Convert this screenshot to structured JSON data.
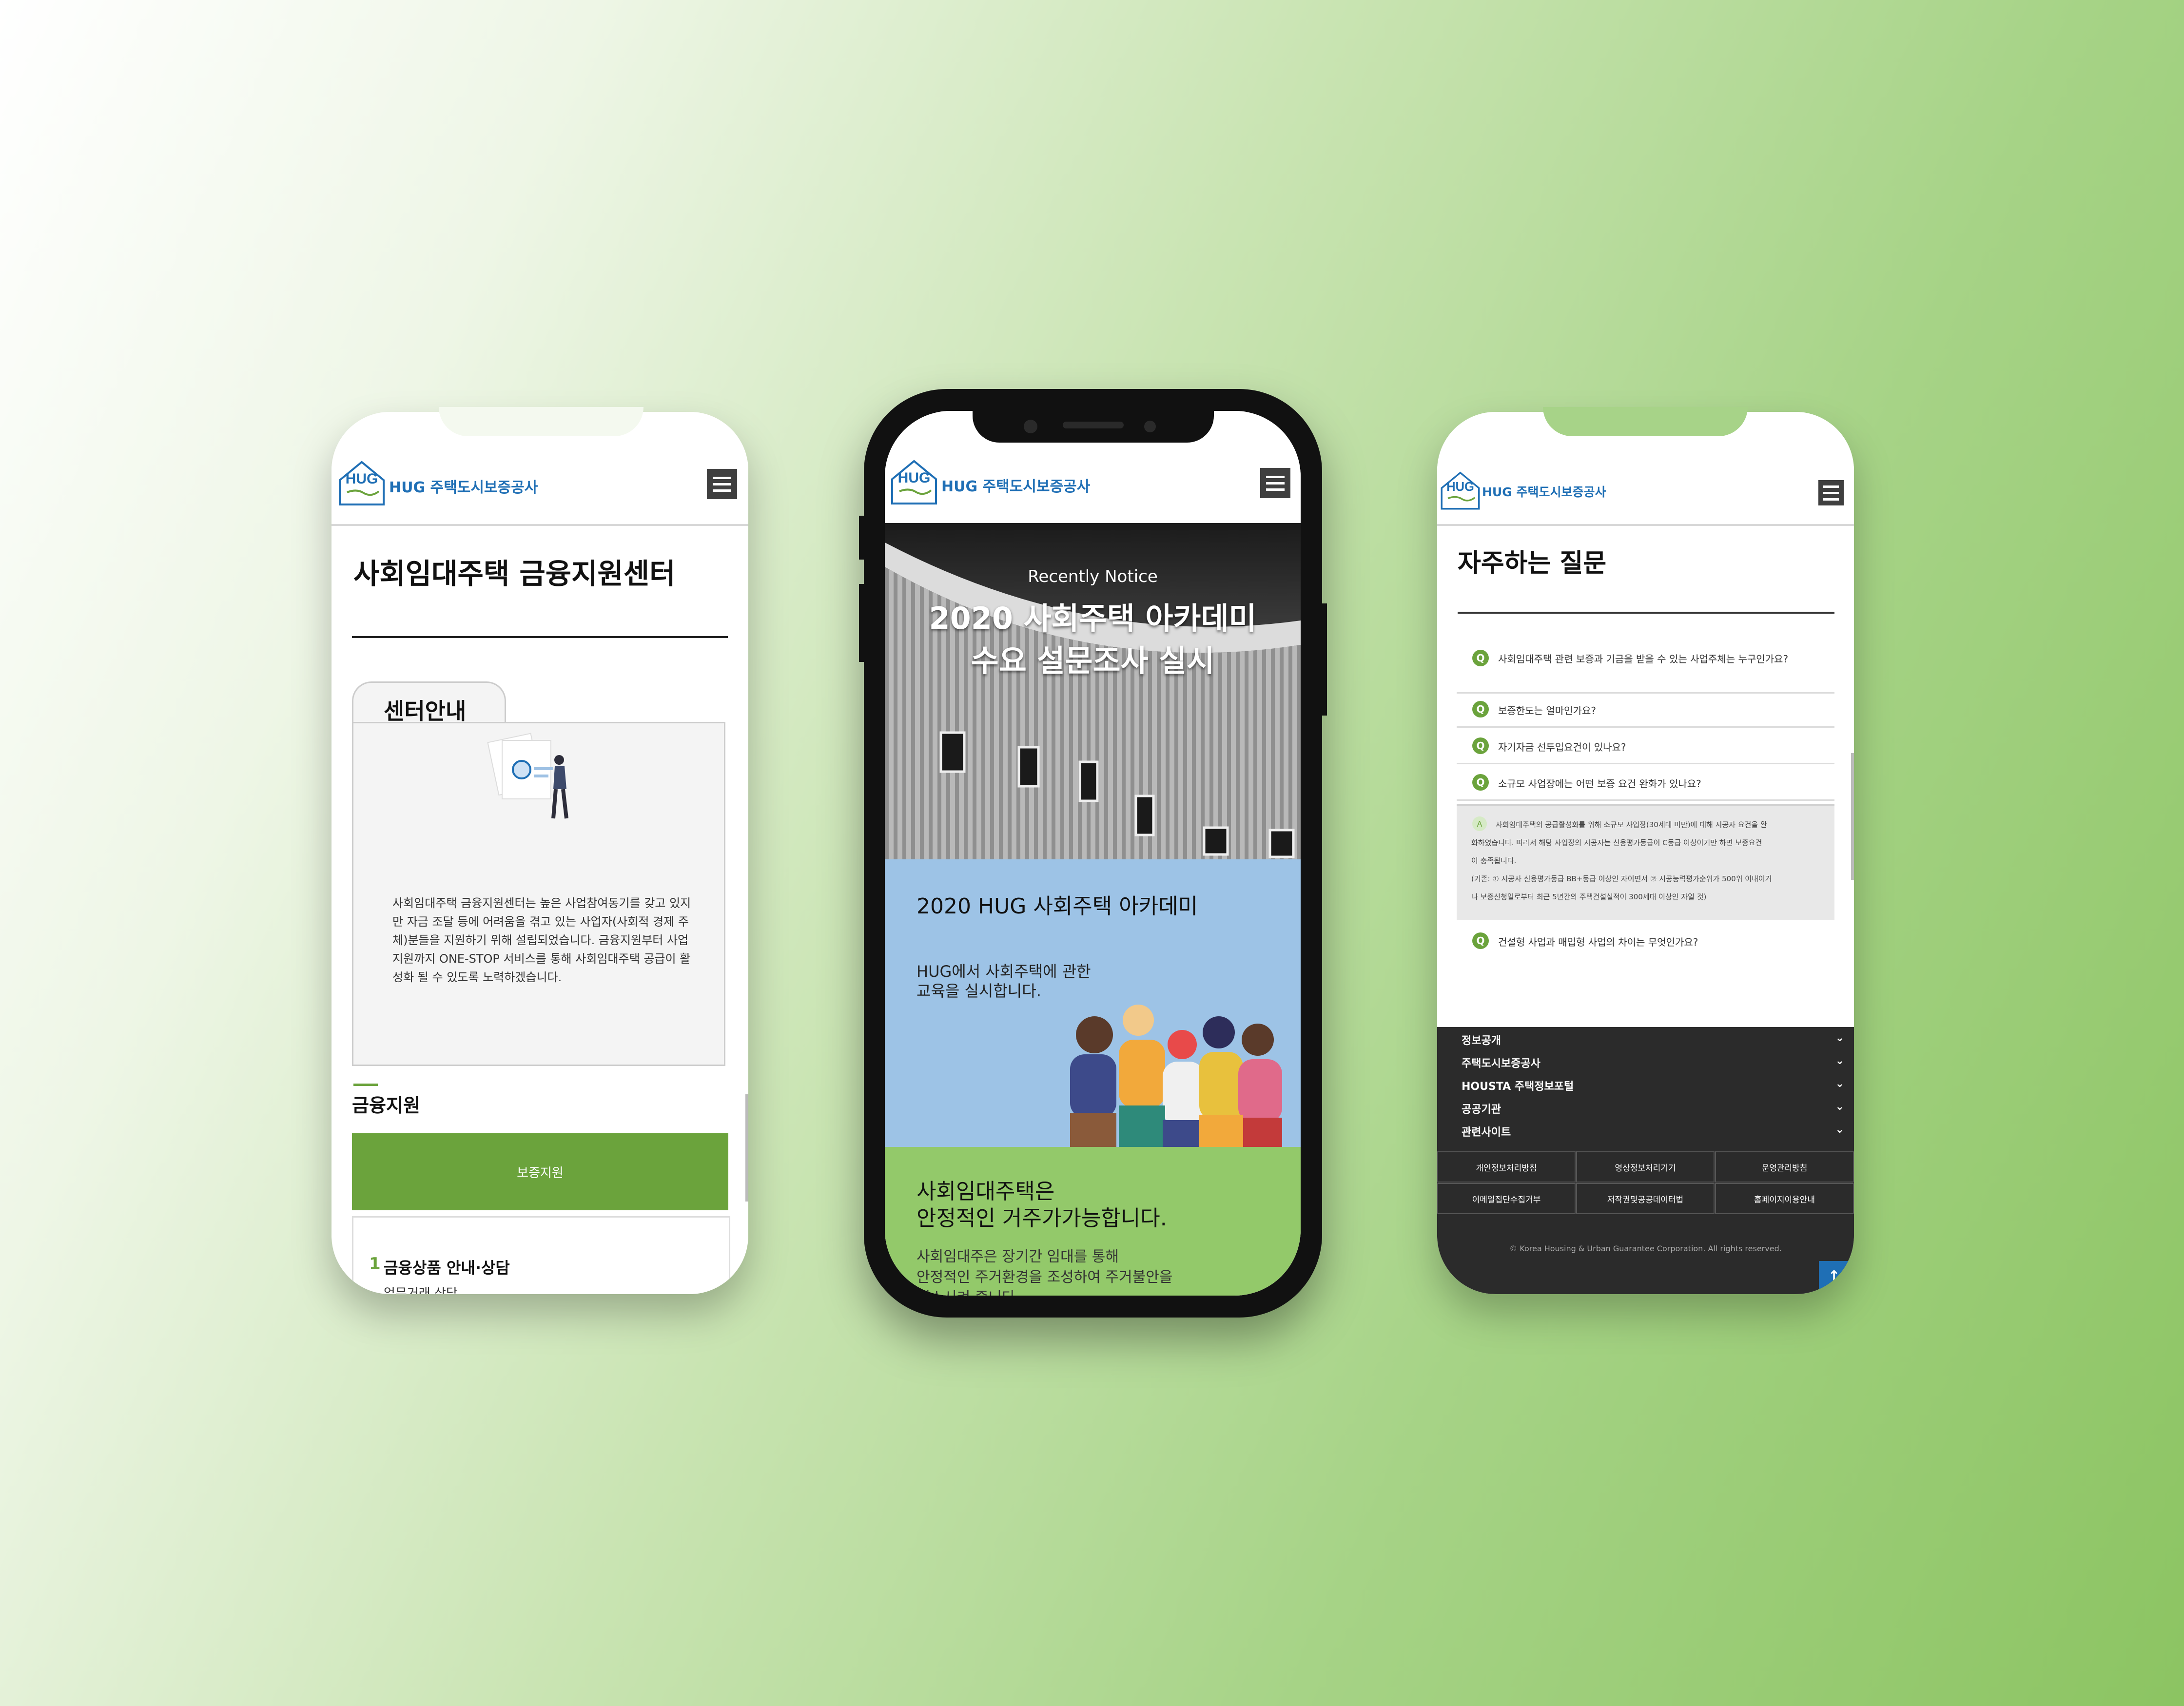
{
  "brand": {
    "logo_mark": "HUG",
    "name": "HUG 주택도시보증공사"
  },
  "left": {
    "title": "사회임대주택 금융지원센터",
    "tab_label": "센터안내",
    "description": "사회임대주택 금융지원센터는 높은 사업참여동기를 갖고 있지만 자금 조달 등에 어려움을 겪고 있는 사업자(사회적 경제 주체)분들을 지원하기 위해 설립되었습니다. 금융지원부터 사업지원까지 ONE-STOP 서비스를 통해 사회임대주택 공급이 활성화 될 수 있도록 노력하겠습니다.",
    "section_title": "금융지원",
    "button_label": "보증지원",
    "item_number": "1",
    "item_title": "금융상품 안내·상담",
    "item_sub": "업무거래 상담"
  },
  "middle": {
    "hero_kicker": "Recently Notice",
    "hero_title_line1": "2020 사회주택 아카데미",
    "hero_title_line2": "수요 설문조사 실시",
    "card_title": "2020 HUG 사회주택 아카데미",
    "card_body_line1": "HUG에서 사회주택에 관한",
    "card_body_line2": "교육을 실시합니다.",
    "green_title_line1": "사회임대주택은",
    "green_title_line2": "안정적인 거주가가능합니다.",
    "green_body_line1": "사회임대주은 장기간 임대를 통해",
    "green_body_line2": "안정적인 주거환경을 조성하여 주거불안을",
    "green_body_line3": "해소시켜 줍니다."
  },
  "right": {
    "title": "자주하는 질문",
    "q_badge": "Q",
    "a_badge": "A",
    "questions": [
      "사회임대주택 관련 보증과 기금을 받을 수 있는 사업주체는 누구인가요?",
      "보증한도는 얼마인가요?",
      "자기자금 선투입요건이 있나요?",
      "소규모 사업장에는 어떤 보증 요건 완화가 있나요?",
      "건설형 사업과 매입형 사업의 차이는 무엇인가요?"
    ],
    "answer_line1": "사회임대주택의 공급활성화를 위해 소규모 사업장(30세대 미만)에 대해 시공자 요건을 완",
    "answer_line2": "화하였습니다. 따라서 해당 사업장의 시공자는 신용평가등급이 C등급 이상이기만 하면 보증요건",
    "answer_line3": "이 충족됩니다.",
    "answer_line4": "(기존: ① 시공사 신용평가등급 BB+등급 이상인 자이면서 ② 시공능력평가순위가 500위 이내이거",
    "answer_line5": "나 보증신청일로부터 최근 5년간의 주택건설실적이 300세대 이상인 자일 것)",
    "footer_menu": [
      "정보공개",
      "주택도시보증공사",
      "HOUSTA 주택정보포털",
      "공공기관",
      "관련사이트"
    ],
    "footer_links": [
      "개인정보처리방침",
      "영상정보처리기기",
      "운영관리방침",
      "이메일집단수집거부",
      "저작권및공공데이터법",
      "홈페이지이용안내"
    ],
    "copyright": "© Korea Housing & Urban Guarantee Corporation. All rights reserved."
  },
  "colors": {
    "green": "#6ba33c",
    "blue_card": "#9dc3e6",
    "green_section": "#93c96a",
    "footer": "#2b2b2b",
    "brand_blue": "#1f6fb5"
  }
}
